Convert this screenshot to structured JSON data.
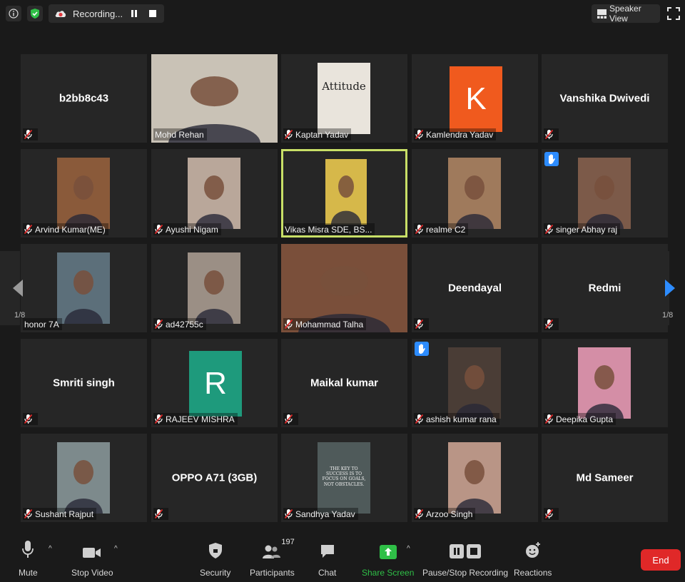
{
  "top": {
    "recording_label": "Recording...",
    "speaker_view_label": "Speaker View"
  },
  "participants": [
    {
      "name": "b2bb8c43",
      "display": "b2bb8c43",
      "video": false,
      "muted": true
    },
    {
      "name": "Mohd Rehan",
      "video": true,
      "muted": false,
      "photo": "#c9c2b6"
    },
    {
      "name": "Kaptan Yadav",
      "video": true,
      "muted": true,
      "photo": "#e9e4dc",
      "photo_text": "Attitude",
      "card": true
    },
    {
      "name": "Kamlendra Yadav",
      "video": true,
      "muted": true,
      "letter": "K",
      "letter_color": "#f05a1e"
    },
    {
      "name": "Vanshika Dwivedi",
      "display": "Vanshika Dwivedi",
      "video": false,
      "muted": true
    },
    {
      "name": "Arvind Kumar(ME)",
      "video": true,
      "muted": true,
      "photo": "#8a5a3a"
    },
    {
      "name": "Ayushi Nigam",
      "video": true,
      "muted": true,
      "photo": "#b9a79a"
    },
    {
      "name": "Vikas Misra SDE, BS...",
      "video": true,
      "muted": false,
      "active": true,
      "photo": "#d6b84a"
    },
    {
      "name": "realme C2",
      "video": true,
      "muted": true,
      "photo": "#9f7a5c"
    },
    {
      "name": "singer Abhay raj",
      "video": true,
      "muted": true,
      "hand": true,
      "photo": "#7c5a49"
    },
    {
      "name": "honor 7A",
      "video": true,
      "muted": false,
      "photo": "#5c6f7a"
    },
    {
      "name": "ad42755c",
      "video": true,
      "muted": true,
      "photo": "#9b8f85"
    },
    {
      "name": "Mohammad Talha",
      "video": true,
      "muted": true,
      "photo": "#7a4f3a"
    },
    {
      "name": "Deendayal",
      "display": "Deendayal",
      "video": false,
      "muted": true
    },
    {
      "name": "Redmi",
      "display": "Redmi",
      "video": false,
      "muted": true
    },
    {
      "name": "Smriti singh",
      "display": "Smriti singh",
      "video": false,
      "muted": true
    },
    {
      "name": "RAJEEV MISHRA",
      "video": true,
      "muted": true,
      "letter": "R",
      "letter_color": "#1e9a7c"
    },
    {
      "name": "Maikal kumar",
      "display": "Maikal kumar",
      "video": false,
      "muted": true
    },
    {
      "name": "ashish kumar rana",
      "video": true,
      "muted": true,
      "hand": true,
      "photo": "#4a3d36"
    },
    {
      "name": "Deepika Gupta",
      "video": true,
      "muted": true,
      "photo": "#d48ea6"
    },
    {
      "name": "Sushant Rajput",
      "video": true,
      "muted": true,
      "photo": "#7d8a8c"
    },
    {
      "name": "OPPO A71 (3GB)",
      "display": "OPPO A71 (3GB)",
      "video": false,
      "muted": true
    },
    {
      "name": "Sandhya Yadav",
      "video": true,
      "muted": true,
      "photo": "#4f5a5a",
      "photo_text": "THE KEY TO SUCCESS IS TO FOCUS ON GOALS, NOT OBSTACLES."
    },
    {
      "name": "Arzoo Singh",
      "video": true,
      "muted": true,
      "photo": "#b99586"
    },
    {
      "name": "Md Sameer",
      "display": "Md Sameer",
      "video": false,
      "muted": true
    }
  ],
  "pagination": {
    "left": "1/8",
    "right": "1/8"
  },
  "toolbar": {
    "mute": "Mute",
    "stop_video": "Stop Video",
    "security": "Security",
    "participants": "Participants",
    "participants_count": "197",
    "chat": "Chat",
    "share_screen": "Share Screen",
    "pause_recording": "Pause/Stop Recording",
    "reactions": "Reactions",
    "end": "End"
  },
  "colors": {
    "active_border": "#c8df67",
    "share_green": "#2fbf47",
    "end_red": "#e02828",
    "hand_blue": "#2d8cff"
  }
}
